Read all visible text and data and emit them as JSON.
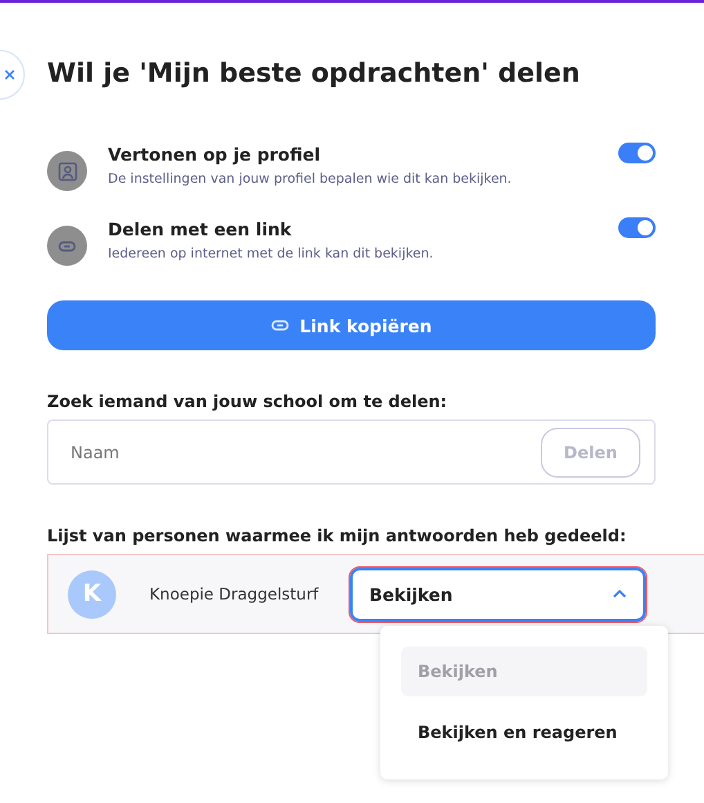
{
  "title": "Wil je 'Mijn beste opdrachten' delen",
  "settings": [
    {
      "kind": "profile",
      "label": "Vertonen op je profiel",
      "description": "De instellingen van jouw profiel bepalen wie dit kan bekijken.",
      "on": true
    },
    {
      "kind": "link",
      "label": "Delen met een link",
      "description": "Iedereen op internet met de link kan dit bekijken.",
      "on": true
    }
  ],
  "copy_button": "Link kopiëren",
  "search": {
    "label": "Zoek iemand van jouw school om te delen:",
    "placeholder": "Naam",
    "button": "Delen",
    "button_disabled": true
  },
  "shared": {
    "label": "Lijst van personen waarmee ik mijn antwoorden heb gedeeld:",
    "people": [
      {
        "initial": "K",
        "name": "Knoepie Draggelsturf",
        "permission": "Bekijken",
        "expanded": true,
        "options": [
          {
            "label": "Bekijken",
            "selected": true
          },
          {
            "label": "Bekijken en reageren",
            "selected": false
          }
        ]
      }
    ]
  }
}
